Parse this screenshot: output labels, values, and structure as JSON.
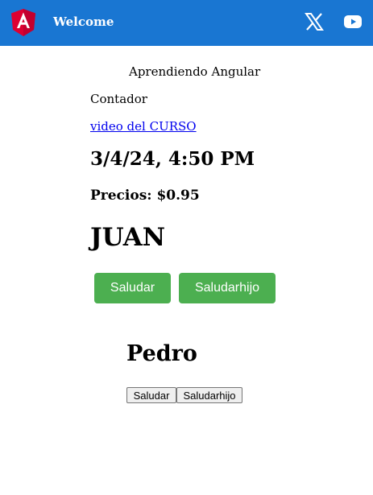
{
  "toolbar": {
    "title": "Welcome",
    "colors": {
      "background": "#1976d2",
      "logo": "#dd0031"
    },
    "icons": [
      "angular-logo",
      "x-twitter-icon",
      "youtube-icon"
    ]
  },
  "main": {
    "intro": "Aprendiendo Angular",
    "contador": "Contador",
    "video_link": "video del CURSO",
    "date": "3/4/24, 4:50 PM",
    "price": "Precios: $0.95",
    "parent_name": "JUAN",
    "buttons": {
      "saludar": "Saludar",
      "saludarhijo": "Saludarhijo",
      "color": "#4caf50"
    }
  },
  "child": {
    "name": "Pedro",
    "buttons": {
      "saludar": "Saludar",
      "saludarhijo": "Saludarhijo"
    }
  }
}
